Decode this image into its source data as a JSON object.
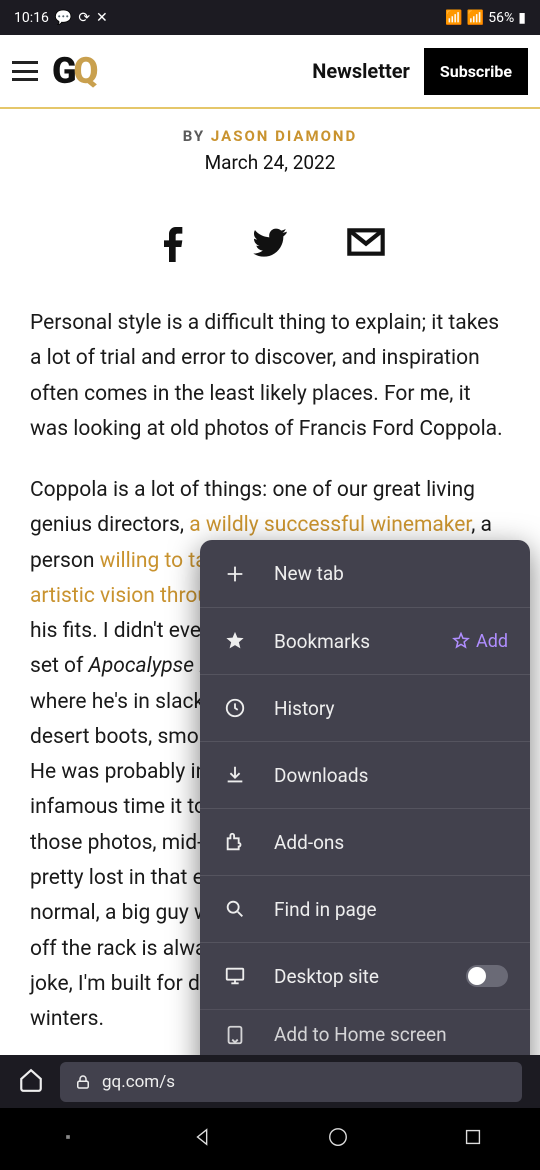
{
  "statusbar": {
    "time": "10:16",
    "battery": "56%"
  },
  "header": {
    "newsletter": "Newsletter",
    "subscribe": "Subscribe"
  },
  "byline": {
    "by": "BY ",
    "author": "JASON DIAMOND"
  },
  "date": "March 24, 2022",
  "article": {
    "p1": "Personal style is a difficult thing to explain; it takes a lot of trial and error to discover, and inspiration often comes in the least likely places. For me, it was looking at old photos of Francis Ford Coppola.",
    "p2_start": "Coppola is a lot of things: one of our great living genius directors, ",
    "p2_link1": "a wildly successful winemaker",
    "p2_mid": ", a person ",
    "p2_link2": "willing to take massive risks to see his artistic vision through",
    "p2_rest": ". He's also the unsung hero of his fits. I didn't even realize this. I was just on the set of ",
    "p2_em": "Apocalypse Now",
    "p2_end": " and there's this iconic shot where he's in slacks and a blue chambray shirt and desert boots, smoking a fake cigar he found on set. He was probably in his early-40s, given the infamous time it took the film. When I first saw those photos, mid-late-30s and, to be honest, I was pretty lost in that era. I've got this body that's normal, a big guy with weird proportions, so buying off the rack is always a challenge. I've heard the joke, I'm built for denim overalls and cold European winters."
  },
  "menu": {
    "new_tab": "New tab",
    "bookmarks": "Bookmarks",
    "add": "Add",
    "history": "History",
    "downloads": "Downloads",
    "addons": "Add-ons",
    "find": "Find in page",
    "desktop": "Desktop site",
    "homescreen": "Add to Home screen"
  },
  "urlbar": {
    "url": "gq.com/s"
  }
}
